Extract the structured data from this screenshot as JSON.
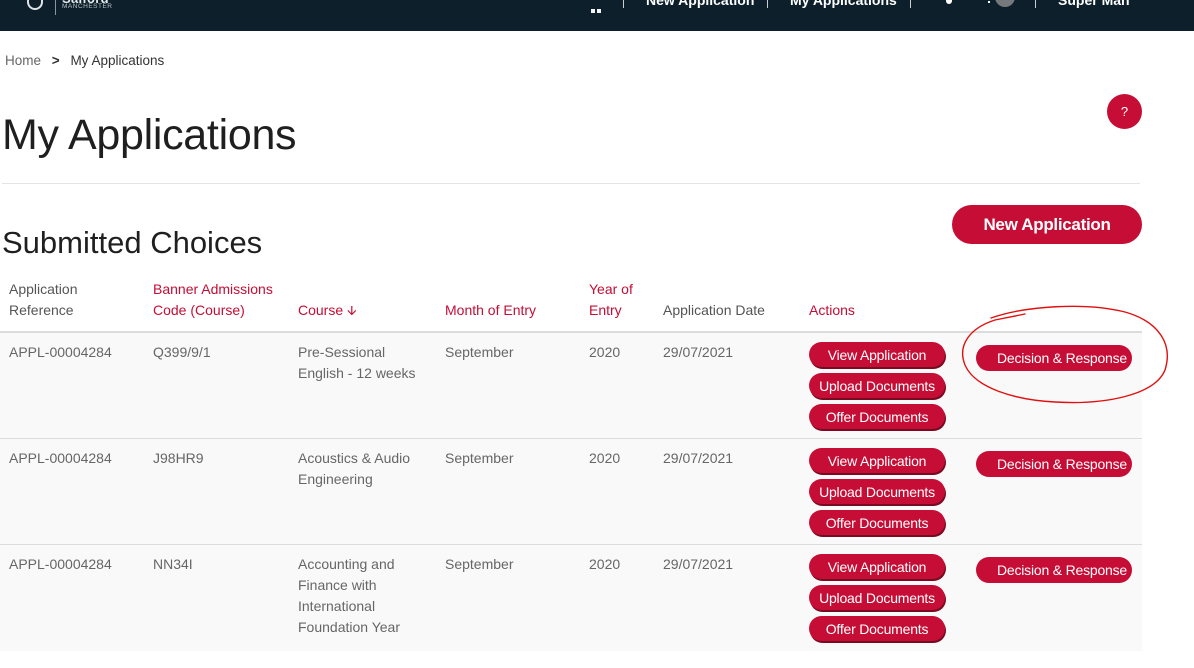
{
  "brand": {
    "name_line1": "Salford",
    "name_line2": "MANCHESTER",
    "logo_icon": "university-shield-icon"
  },
  "topnav": {
    "items": [
      {
        "label": "New Application"
      },
      {
        "label": "My Applications"
      }
    ],
    "user_name": "Super Man",
    "icons": [
      "apps-grid-icon",
      "notification-bell-icon",
      "user-avatar-icon"
    ]
  },
  "breadcrumb": {
    "home": "Home",
    "separator": ">",
    "current": "My Applications"
  },
  "page": {
    "title": "My Applications",
    "help_label": "?",
    "section_title": "Submitted Choices",
    "new_application_label": "New Application"
  },
  "colors": {
    "accent": "#c50d35",
    "nav_bg": "#0c1f2b",
    "row_bg": "#f9f9f9",
    "annotation": "#e01010"
  },
  "table": {
    "headers": {
      "ref": [
        "Application",
        "Reference"
      ],
      "code": [
        "Banner Admissions",
        "Code (Course)"
      ],
      "course": "Course",
      "course_sort": "descending",
      "month": "Month of Entry",
      "year": [
        "Year of",
        "Entry"
      ],
      "date": "Application Date",
      "actions": "Actions"
    },
    "rows": [
      {
        "ref": "APPL-00004284",
        "code": "Q399/9/1",
        "course": [
          "Pre-Sessional",
          "English - 12 weeks"
        ],
        "month": "September",
        "year": "2020",
        "date": "29/07/2021",
        "actions": [
          "View Application",
          "Upload Documents",
          "Offer Documents"
        ],
        "decision": "Decision & Response",
        "annotated": true
      },
      {
        "ref": "APPL-00004284",
        "code": "J98HR9",
        "course": [
          "Acoustics & Audio",
          "Engineering"
        ],
        "month": "September",
        "year": "2020",
        "date": "29/07/2021",
        "actions": [
          "View Application",
          "Upload Documents",
          "Offer Documents"
        ],
        "decision": "Decision & Response",
        "annotated": false
      },
      {
        "ref": "APPL-00004284",
        "code": "NN34I",
        "course": [
          "Accounting and",
          "Finance with",
          "International",
          "Foundation Year"
        ],
        "month": "September",
        "year": "2020",
        "date": "29/07/2021",
        "actions": [
          "View Application",
          "Upload Documents",
          "Offer Documents"
        ],
        "decision": "Decision & Response",
        "annotated": false
      }
    ]
  }
}
